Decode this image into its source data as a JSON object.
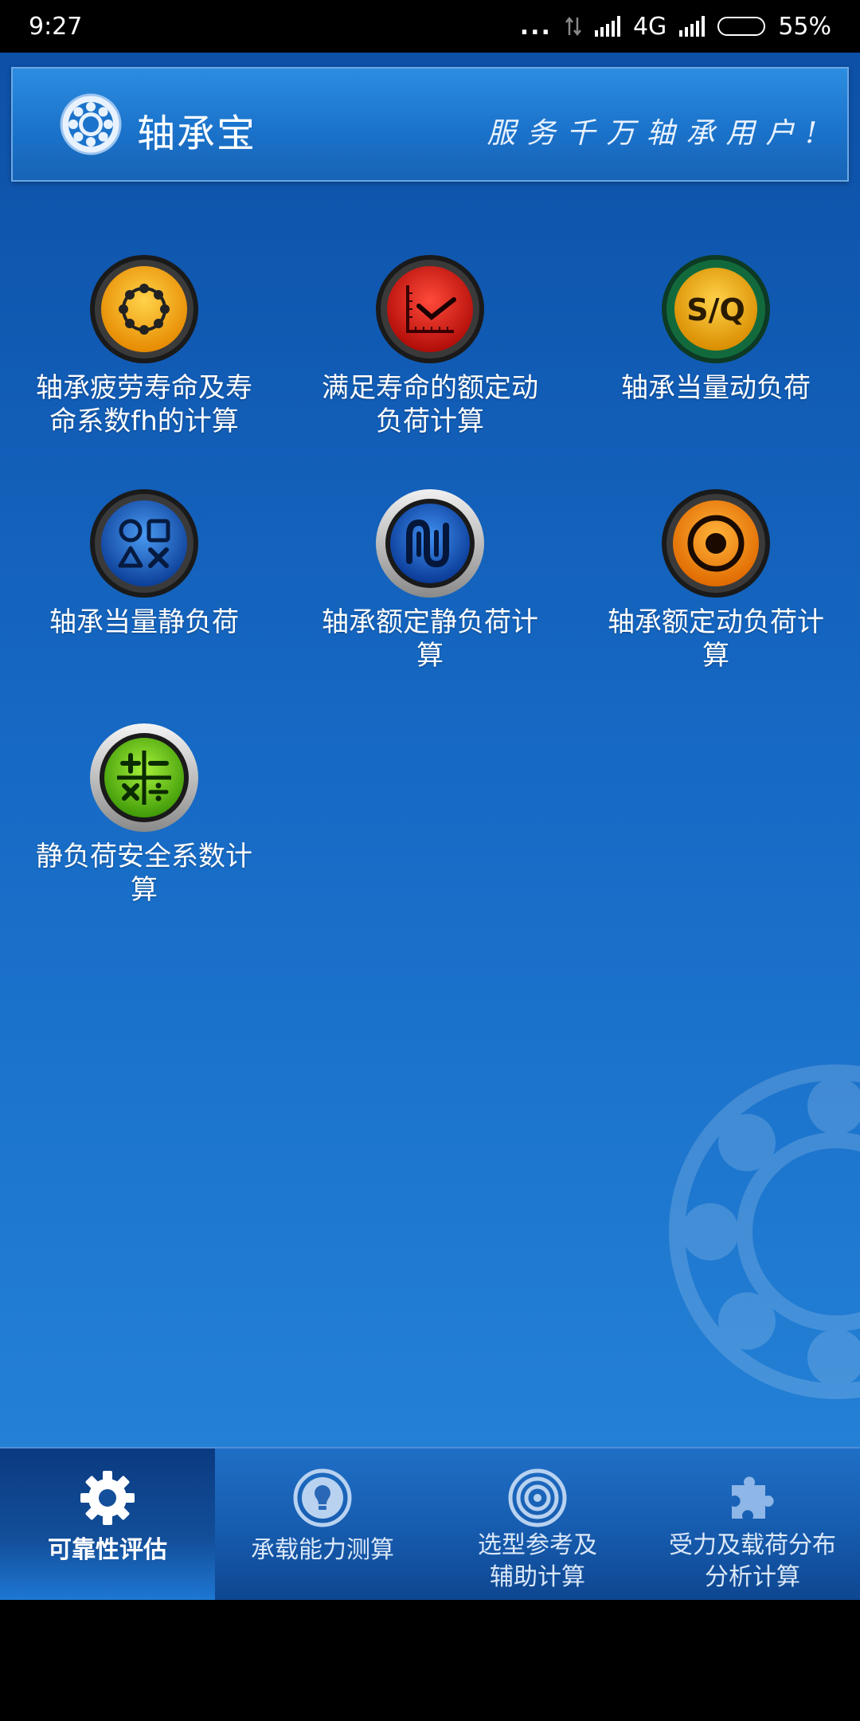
{
  "status_bar": {
    "time": "9:27",
    "dots": "...",
    "network": "4G",
    "battery": "55%",
    "battery_level": 0.55
  },
  "header": {
    "title": "轴承宝",
    "slogan": "服务千万轴承用户!"
  },
  "grid": [
    {
      "label": "轴承疲劳寿命及寿命系数fh的计算",
      "icon": "bearing-icon",
      "color": "#f5a20a"
    },
    {
      "label": "满足寿命的额定动负荷计算",
      "icon": "chart-check-icon",
      "color": "#e01a14"
    },
    {
      "label": "轴承当量动负荷",
      "icon": "sq-icon",
      "color": "#f2b418"
    },
    {
      "label": "轴承当量静负荷",
      "icon": "shapes-icon",
      "color": "#1c64c8"
    },
    {
      "label": "轴承额定静负荷计算",
      "icon": "wave-icon",
      "color": "#0e4fb5"
    },
    {
      "label": "轴承额定动负荷计算",
      "icon": "target-icon",
      "color": "#f58a0c"
    },
    {
      "label": "静负荷安全系数计算",
      "icon": "calculator-icon",
      "color": "#6cc418"
    }
  ],
  "nav": [
    {
      "label": "可靠性评估",
      "icon": "gear-icon"
    },
    {
      "label": "承载能力测算",
      "icon": "lightbulb-icon"
    },
    {
      "label": "选型参考及\n辅助计算",
      "icon": "target-icon"
    },
    {
      "label": "受力及载荷分布\n分析计算",
      "icon": "puzzle-icon"
    }
  ]
}
